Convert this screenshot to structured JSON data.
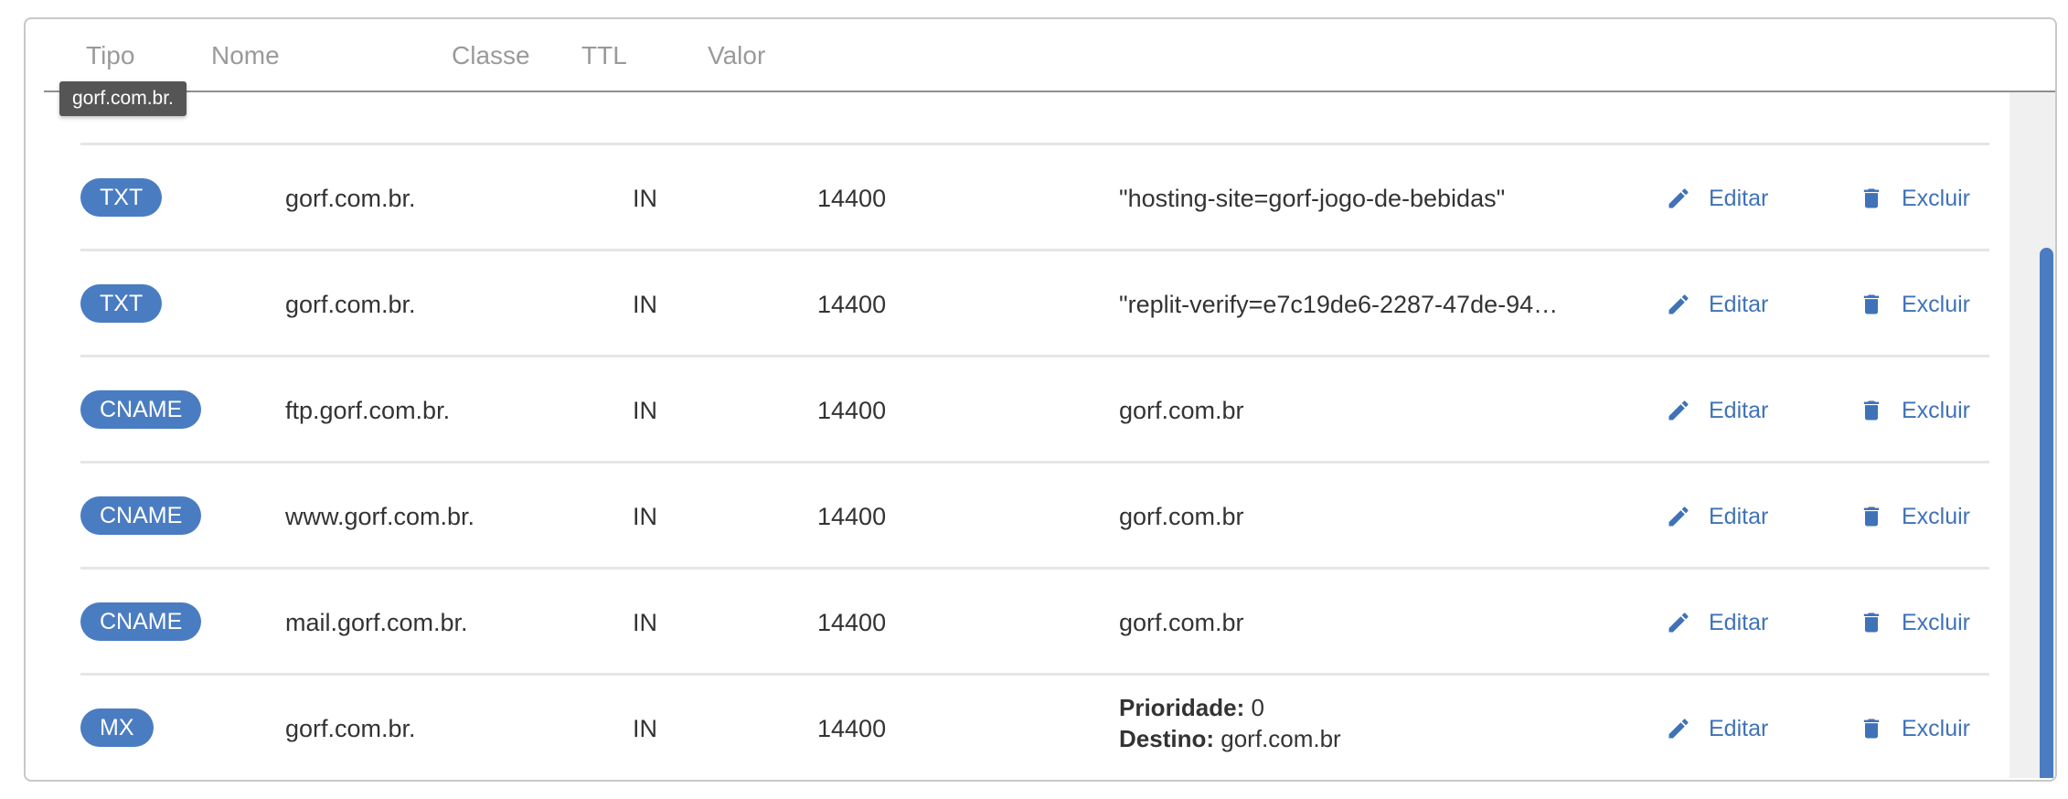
{
  "colors": {
    "accent": "#4a7cc2",
    "link": "#3f72b8",
    "header_text": "#9a9a9a",
    "body_text": "#333333"
  },
  "table": {
    "headers": {
      "type": "Tipo",
      "name": "Nome",
      "class": "Classe",
      "ttl": "TTL",
      "value": "Valor"
    },
    "tooltip": "gorf.com.br.",
    "actions": {
      "edit_label": "Editar",
      "delete_label": "Excluir",
      "edit_icon": "pencil-icon",
      "delete_icon": "trash-icon"
    },
    "rows": [
      {
        "type": "TXT",
        "name": "gorf.com.br.",
        "class": "IN",
        "ttl": "14400",
        "value": "\"hosting-site=gorf-jogo-de-bebidas\""
      },
      {
        "type": "TXT",
        "name": "gorf.com.br.",
        "class": "IN",
        "ttl": "14400",
        "value": "\"replit-verify=e7c19de6-2287-47de-94…"
      },
      {
        "type": "CNAME",
        "name": "ftp.gorf.com.br.",
        "class": "IN",
        "ttl": "14400",
        "value": "gorf.com.br"
      },
      {
        "type": "CNAME",
        "name": "www.gorf.com.br.",
        "class": "IN",
        "ttl": "14400",
        "value": "gorf.com.br"
      },
      {
        "type": "CNAME",
        "name": "mail.gorf.com.br.",
        "class": "IN",
        "ttl": "14400",
        "value": "gorf.com.br"
      },
      {
        "type": "MX",
        "name": "gorf.com.br.",
        "class": "IN",
        "ttl": "14400",
        "priority_label": "Prioridade:",
        "priority": "0",
        "destination_label": "Destino:",
        "destination": "gorf.com.br"
      }
    ]
  }
}
